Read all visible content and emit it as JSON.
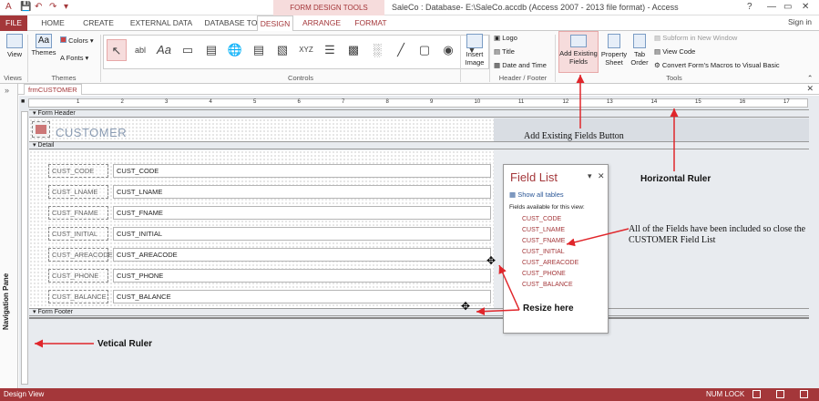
{
  "quick_access": {
    "file_icon": "access-icon",
    "save": "save-icon",
    "undo": "undo-icon",
    "redo": "redo-icon",
    "more": "dropdown-icon"
  },
  "context_title": "FORM DESIGN TOOLS",
  "window_title": "SaleCo : Database- E:\\SaleCo.accdb (Access 2007 - 2013 file format) - Access",
  "window_controls": {
    "help": "?",
    "minimize": "—",
    "restore": "▭",
    "close": "✕"
  },
  "tabs": [
    "FILE",
    "HOME",
    "CREATE",
    "EXTERNAL DATA",
    "DATABASE TOOLS",
    "DESIGN",
    "ARRANGE",
    "FORMAT"
  ],
  "sign_in": "Sign in",
  "ribbon": {
    "view_label": "View",
    "themes_label": "Themes",
    "colors_label": "Colors",
    "fonts_label": "Fonts",
    "groups": {
      "views": "Views",
      "themes": "Themes",
      "controls": "Controls",
      "header_footer": "Header / Footer",
      "tools": "Tools"
    },
    "insert_image": "Insert Image",
    "logo": "Logo",
    "title": "Title",
    "date_time": "Date and Time",
    "add_existing_fields": "Add Existing Fields",
    "property_sheet": "Property Sheet",
    "tab_order": "Tab Order",
    "subform_new_window": "Subform in New Window",
    "view_code": "View Code",
    "convert_macros": "Convert Form's Macros to Visual Basic",
    "control_icons": [
      "select-arrow-icon",
      "textbox-icon",
      "label-icon",
      "button-icon",
      "tab-control-icon",
      "hyperlink-icon",
      "web-browser-icon",
      "navigation-control-icon",
      "option-group-icon",
      "page-break-icon",
      "combo-box-icon",
      "chart-icon",
      "line-icon",
      "toggle-button-icon"
    ]
  },
  "document_tab": "frmCUSTOMER",
  "navigation_pane": "Navigation Pane",
  "sections": {
    "header": "Form Header",
    "detail": "Detail",
    "footer": "Form Footer"
  },
  "form_title": "CUSTOMER",
  "fields": [
    {
      "label": "CUST_CODE",
      "control": "CUST_CODE"
    },
    {
      "label": "CUST_LNAME",
      "control": "CUST_LNAME"
    },
    {
      "label": "CUST_FNAME",
      "control": "CUST_FNAME"
    },
    {
      "label": "CUST_INITIAL",
      "control": "CUST_INITIAL"
    },
    {
      "label": "CUST_AREACODE",
      "control": "CUST_AREACODE"
    },
    {
      "label": "CUST_PHONE",
      "control": "CUST_PHONE"
    },
    {
      "label": "CUST_BALANCE",
      "control": "CUST_BALANCE"
    }
  ],
  "ruler_numbers": [
    "1",
    "2",
    "3",
    "4",
    "5",
    "6",
    "7",
    "8",
    "9",
    "10",
    "11",
    "12",
    "13",
    "14",
    "15",
    "16",
    "17"
  ],
  "field_list": {
    "title": "Field List",
    "show_all": "Show all tables",
    "available": "Fields available for this view:",
    "items": [
      "CUST_CODE",
      "CUST_LNAME",
      "CUST_FNAME",
      "CUST_INITIAL",
      "CUST_AREACODE",
      "CUST_PHONE",
      "CUST_BALANCE"
    ]
  },
  "annotations": {
    "add_fields": "Add Existing Fields Button",
    "horizontal_ruler": "Horizontal Ruler",
    "close_list": "All of the Fields have been included so close the CUSTOMER Field List",
    "resize": "Resize here",
    "vertical_ruler": "Vetical Ruler"
  },
  "status": {
    "left": "Design View",
    "right": "NUM LOCK"
  },
  "colors": {
    "accent": "#a4373a",
    "annotation_arrow": "#e0262b"
  }
}
